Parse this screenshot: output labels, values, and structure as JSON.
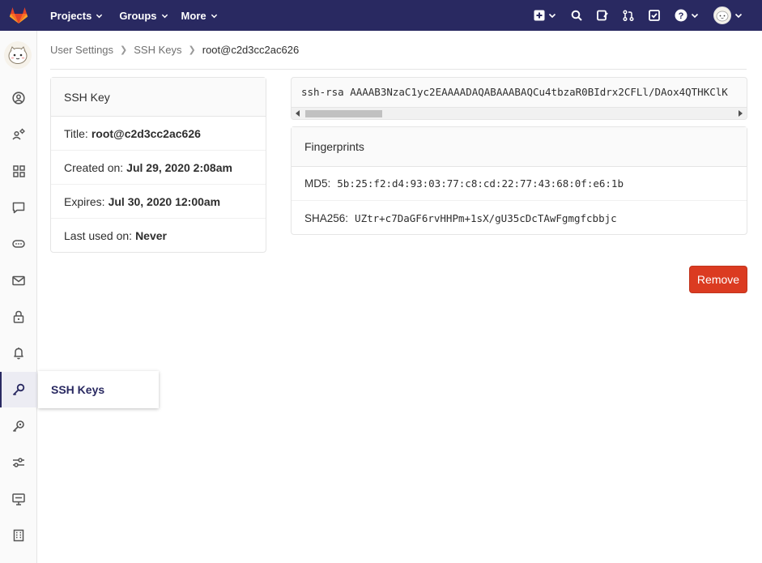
{
  "topnav": {
    "projects": "Projects",
    "groups": "Groups",
    "more": "More",
    "icons": [
      "plus-icon",
      "search-icon",
      "issues-icon",
      "merge-request-icon",
      "todo-icon",
      "help-icon"
    ]
  },
  "sidebar": {
    "items": [
      {
        "name": "profile",
        "icon": "user-circle-icon"
      },
      {
        "name": "account",
        "icon": "account-icon"
      },
      {
        "name": "applications",
        "icon": "grid-icon"
      },
      {
        "name": "chat",
        "icon": "chat-icon"
      },
      {
        "name": "access-tokens",
        "icon": "token-icon"
      },
      {
        "name": "emails",
        "icon": "mail-icon"
      },
      {
        "name": "password",
        "icon": "lock-icon"
      },
      {
        "name": "notifications",
        "icon": "bell-icon"
      },
      {
        "name": "ssh-keys",
        "icon": "key-icon",
        "active": true
      },
      {
        "name": "gpg-keys",
        "icon": "key-alt-icon"
      },
      {
        "name": "preferences",
        "icon": "preferences-icon"
      },
      {
        "name": "active-sessions",
        "icon": "monitor-icon"
      },
      {
        "name": "audit-log",
        "icon": "log-icon"
      }
    ],
    "flyout_label": "SSH Keys"
  },
  "breadcrumb": {
    "items": [
      "User Settings",
      "SSH Keys"
    ],
    "current": "root@c2d3cc2ac626"
  },
  "ssh_key_card": {
    "header": "SSH Key",
    "title_label": "Title:",
    "title_value": "root@c2d3cc2ac626",
    "created_label": "Created on:",
    "created_value": "Jul 29, 2020 2:08am",
    "expires_label": "Expires:",
    "expires_value": "Jul 30, 2020 12:00am",
    "last_used_label": "Last used on:",
    "last_used_value": "Never"
  },
  "key_text": "ssh-rsa AAAAB3NzaC1yc2EAAAADAQABAAABAQCu4tbzaR0BIdrx2CFLl/DAox4QTHKClK",
  "fingerprints": {
    "header": "Fingerprints",
    "md5_label": "MD5:",
    "md5_value": "5b:25:f2:d4:93:03:77:c8:cd:22:77:43:68:0f:e6:1b",
    "sha256_label": "SHA256:",
    "sha256_value": "UZtr+c7DaGF6rvHHPm+1sX/gU35cDcTAwFgmgfcbbjc"
  },
  "actions": {
    "remove": "Remove"
  },
  "colors": {
    "nav_bg": "#292961",
    "remove_bg": "#db3b21",
    "flyout_text": "#292961"
  }
}
